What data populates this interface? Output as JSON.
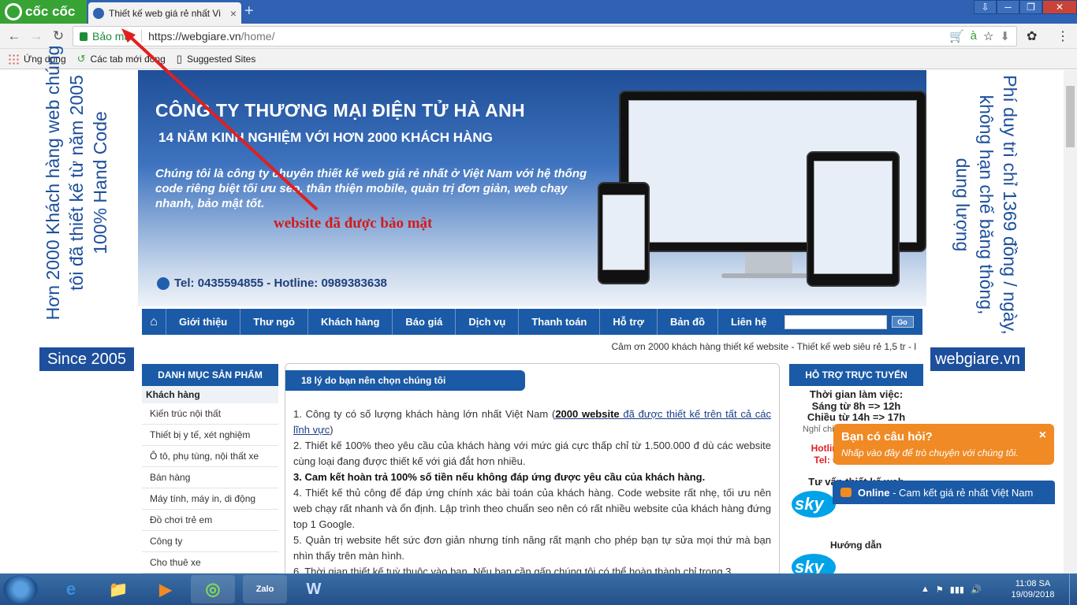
{
  "browser": {
    "brand": "cốc cốc",
    "tab_title": "Thiết kế web giá rẻ nhất Vi",
    "tab_close": "×",
    "new_tab": "+",
    "win_controls": [
      "⇩",
      "─",
      "❐",
      "✕"
    ],
    "nav": {
      "back": "←",
      "forward": "→",
      "reload": "↻"
    },
    "security_label": "Bảo mật",
    "url_main": "https://webgiare.vn",
    "url_path": "/home/",
    "omni_icons": [
      "🛒",
      "à",
      "☆",
      "⬇"
    ],
    "ext_icon": "✿",
    "menu_icon": "⋮"
  },
  "bookmarks": [
    {
      "label": "Ứng dụng"
    },
    {
      "label": "Các tab mới đóng"
    },
    {
      "label": "Suggested Sites"
    }
  ],
  "banner": {
    "title": "CÔNG TY THƯƠNG MẠI ĐIỆN TỬ HÀ ANH",
    "subtitle": "14 NĂM KINH NGHIỆM VỚI HƠN 2000 KHÁCH HÀNG",
    "description": "Chúng tôi là công ty chuyên thiết kế web giá rẻ nhất ở Việt Nam với hệ thống code riêng biệt tối ưu seo, thân thiện mobile, quản trị đơn giản, web chạy nhanh, bảo mật tốt.",
    "secure_annotation": "website đã được bảo mật",
    "tel": "Tel: 0435594855 - Hotline: 0989383638"
  },
  "nav": {
    "home_icon": "⌂",
    "items": [
      "Giới thiệu",
      "Thư ngỏ",
      "Khách hàng",
      "Báo giá",
      "Dịch vụ",
      "Thanh toán",
      "Hỗ trợ",
      "Bản đồ",
      "Liên hệ"
    ],
    "search_button": "Go"
  },
  "marquee": "Cảm ơn 2000 khách hàng thiết kế website - Thiết kế web siêu rẻ 1,5 tr - l",
  "left_vertical": [
    "Hơn 2000 Khách hàng web chúng",
    "tôi đã thiết kế từ năm 2005",
    "100% Hand Code"
  ],
  "since_label": "Since 2005",
  "right_vertical": [
    "Phí duy trì chỉ 1369 đồng / ngày,",
    "không hạn chế băng thông,",
    "dung lượng"
  ],
  "domain_label": "webgiare.vn",
  "categories": {
    "header": "DANH MỤC SẢN PHẨM",
    "group": "Khách hàng",
    "items": [
      "Kiến trúc nội thất",
      "Thiết bị y tế, xét nghiệm",
      "Ô tô, phụ tùng, nội thất xe",
      "Bán hàng",
      "Máy tính, máy in, di động",
      "Đồ chơi trẻ em",
      "Công ty",
      "Cho thuê xe"
    ]
  },
  "main": {
    "header": "18 lý do bạn nên chọn chúng tôi",
    "p1_pre": "1. Công ty có số lượng khách hàng lớn nhất Việt Nam (",
    "p1_link_bold": "2000 website",
    "p1_link": " đã được thiết kế trên tất cả các lĩnh vực",
    "p1_post": ")",
    "p2": "2. Thiết kế 100% theo yêu cầu của khách hàng với mức giá cực thấp chỉ từ 1.500.000 đ dù các website cùng loại đang được thiết kế với giá đắt hơn nhiều.",
    "p3": "3. Cam kết hoàn trả 100% số tiền nếu không đáp ứng được yêu cầu của khách hàng.",
    "p4": "4. Thiết kế thủ công để đáp ứng chính xác bài toán của khách hàng. Code website rất nhẹ, tối ưu nên web chạy rất nhanh và ổn định. Lập trình theo chuẩn seo nên có rất nhiều website của khách hàng đứng top 1 Google.",
    "p5": "5. Quản trị website hết sức đơn giản nhưng tính năng rất mạnh cho phép bạn tự sửa mọi thứ mà bạn nhìn thấy trên màn hình.",
    "p6": "6. Thời gian thiết kế tuỳ thuộc vào bạn. Nếu bạn cần gấp chúng tôi có thể hoàn thành chỉ trong 3"
  },
  "support": {
    "header": "HỖ TRỢ TRỰC TUYẾN",
    "hours_title": "Thời gian làm việc:",
    "morning": "Sáng từ 8h => 12h",
    "afternoon": "Chiều từ 14h => 17h",
    "note": "Nghỉ chiều thứ 7 + ngày CN",
    "hotline": "Hotline: 0989383638",
    "tel": "Tel: 0243.55 948 55",
    "consult": "Tư vấn thiết kế web",
    "guide": "Hướng dẫn",
    "skype": "sky"
  },
  "chat": {
    "question": "Bạn có câu hỏi?",
    "sub": "Nhấp vào đây để trò chuyện với chúng tôi.",
    "close": "×",
    "online": "Online",
    "online_text": " - Cam kết giá rẻ nhất Việt Nam"
  },
  "taskbar": {
    "apps": [
      "e",
      "📁",
      "▶",
      "◎",
      "Zalo",
      "W"
    ],
    "tray_icons": [
      "▲",
      "⚑",
      "▮▮▮",
      "🔊"
    ],
    "time": "11:08 SA",
    "date": "19/09/2018"
  },
  "colors": {
    "brand_blue": "#1a5aa6",
    "accent_green": "#38a335",
    "chat_orange": "#f08a24",
    "annotation_red": "#d21b1b"
  }
}
